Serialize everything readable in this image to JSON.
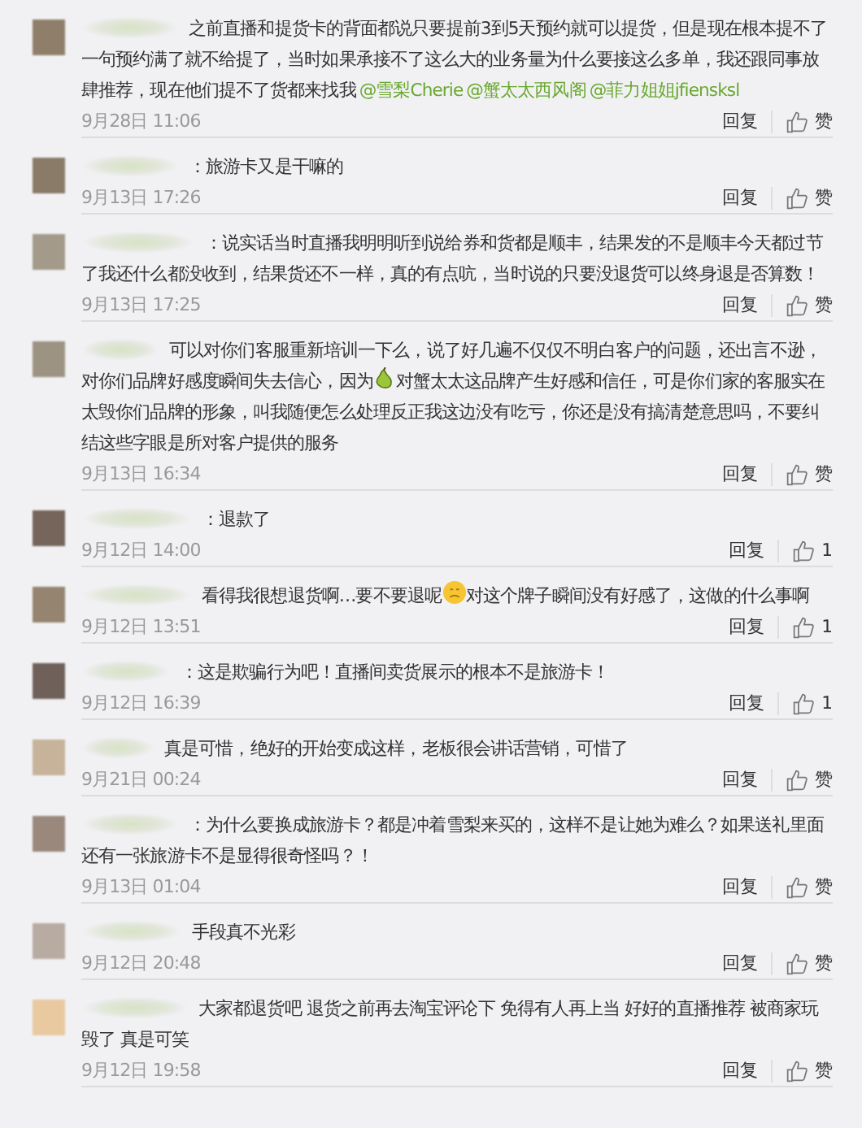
{
  "comments": [
    {
      "segments": [
        {
          "kind": "text",
          "text": "之前直播和提货卡的背面都说只要提前3到5天预约就可以提货，但是现在根本提不了一句预约满了就不给提了，当时如果承接不了这么大的业务量为什么要接这么多单，我还跟同事放肆推荐，现在他们提不了货都来找我"
        },
        {
          "kind": "mention",
          "text": "@雪梨Cherie"
        },
        {
          "kind": "mention",
          "text": "@蟹太太西风阁"
        },
        {
          "kind": "mention",
          "text": "@菲力姐姐jfiensksl"
        }
      ],
      "time": "9月28日 11:06",
      "reply": "回复",
      "like": "赞"
    },
    {
      "segments": [
        {
          "kind": "text",
          "text": "：旅游卡又是干嘛的"
        }
      ],
      "time": "9月13日 17:26",
      "reply": "回复",
      "like": "赞"
    },
    {
      "segments": [
        {
          "kind": "text",
          "text": "：说实话当时直播我明明听到说给券和货都是顺丰，结果发的不是顺丰今天都过节了我还什么都没收到，结果货还不一样，真的有点吭，当时说的只要没退货可以终身退是否算数！"
        }
      ],
      "time": "9月13日 17:25",
      "reply": "回复",
      "like": "赞"
    },
    {
      "segments": [
        {
          "kind": "text",
          "text": "可以对你们客服重新培训一下么，说了好几遍不仅仅不明白客户的问题，还出言不逊，对你们品牌好感度瞬间失去信心，因为"
        },
        {
          "kind": "pear"
        },
        {
          "kind": "text",
          "text": "对蟹太太这品牌产生好感和信任，可是你们家的客服实在太毁你们品牌的形象，叫我随便怎么处理反正我这边没有吃亏，你还是没有搞清楚意思吗，不要纠结这些字眼是所对客户提供的服务"
        }
      ],
      "time": "9月13日 16:34",
      "reply": "回复",
      "like": "赞"
    },
    {
      "segments": [
        {
          "kind": "text",
          "text": "：退款了"
        }
      ],
      "time": "9月12日 14:00",
      "reply": "回复",
      "like": "1"
    },
    {
      "segments": [
        {
          "kind": "text",
          "text": "看得我很想退货啊…要不要退呢"
        },
        {
          "kind": "smiley"
        },
        {
          "kind": "text",
          "text": "对这个牌子瞬间没有好感了，这做的什么事啊"
        }
      ],
      "time": "9月12日 13:51",
      "reply": "回复",
      "like": "1"
    },
    {
      "segments": [
        {
          "kind": "text",
          "text": "：这是欺骗行为吧！直播间卖货展示的根本不是旅游卡！"
        }
      ],
      "time": "9月12日 16:39",
      "reply": "回复",
      "like": "1"
    },
    {
      "segments": [
        {
          "kind": "text",
          "text": "真是可惜，绝好的开始变成这样，老板很会讲话营销，可惜了"
        }
      ],
      "time": "9月21日 00:24",
      "reply": "回复",
      "like": "赞"
    },
    {
      "segments": [
        {
          "kind": "text",
          "text": "：为什么要换成旅游卡？都是冲着雪梨来买的，这样不是让她为难么？如果送礼里面还有一张旅游卡不是显得很奇怪吗？！"
        }
      ],
      "time": "9月13日 01:04",
      "reply": "回复",
      "like": "赞"
    },
    {
      "segments": [
        {
          "kind": "text",
          "text": "手段真不光彩"
        }
      ],
      "time": "9月12日 20:48",
      "reply": "回复",
      "like": "赞"
    },
    {
      "segments": [
        {
          "kind": "text",
          "text": "大家都退货吧 退货之前再去淘宝评论下 免得有人再上当 好好的直播推荐 被商家玩毁了 真是可笑"
        }
      ],
      "time": "9月12日 19:58",
      "reply": "回复",
      "like": "赞"
    }
  ]
}
